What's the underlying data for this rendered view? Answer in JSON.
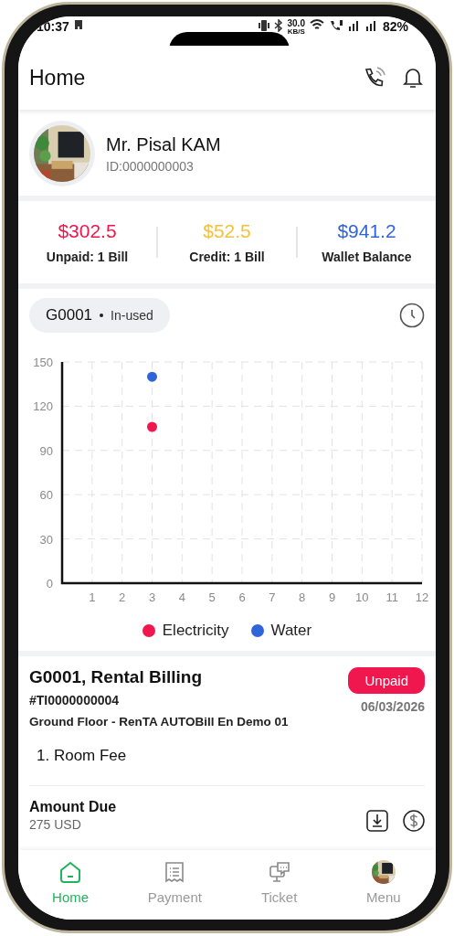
{
  "status_bar": {
    "time": "10:37",
    "speed": "30.0",
    "speed_unit": "KB/S",
    "battery": "82%"
  },
  "header": {
    "title": "Home"
  },
  "profile": {
    "name": "Mr. Pisal KAM",
    "id": "ID:0000000003"
  },
  "balances": [
    {
      "amount": "$302.5",
      "label": "Unpaid: 1 Bill",
      "color": "#f0174f"
    },
    {
      "amount": "$52.5",
      "label": "Credit: 1 Bill",
      "color": "#f5c03c"
    },
    {
      "amount": "$941.2",
      "label": "Wallet Balance",
      "color": "#2f65d8"
    }
  ],
  "usage": {
    "room": "G0001",
    "status": "In-used",
    "chart_data": {
      "type": "scatter",
      "grid": true,
      "x": [
        3
      ],
      "xlim": [
        0,
        12
      ],
      "ylim": [
        0,
        150
      ],
      "xticks": [
        1,
        2,
        3,
        4,
        5,
        6,
        7,
        8,
        9,
        10,
        11,
        12
      ],
      "yticks": [
        0,
        30,
        60,
        90,
        120,
        150
      ],
      "series": [
        {
          "name": "Electricity",
          "color": "#f0174f",
          "values": [
            106
          ]
        },
        {
          "name": "Water",
          "color": "#2f65d8",
          "values": [
            140
          ]
        }
      ]
    }
  },
  "bill": {
    "title": "G0001, Rental Billing",
    "number": "#TI0000000004",
    "location": "Ground Floor - RenTA AUTOBill En Demo 01",
    "status": "Unpaid",
    "date": "06/03/2026",
    "items": [
      "1. Room Fee"
    ],
    "amount_label": "Amount Due",
    "amount": "275 USD"
  },
  "nav": [
    {
      "label": "Home",
      "kind": "home",
      "selected": true
    },
    {
      "label": "Payment",
      "kind": "payment",
      "selected": false
    },
    {
      "label": "Ticket",
      "kind": "ticket",
      "selected": false
    },
    {
      "label": "Menu",
      "kind": "menu",
      "selected": false
    }
  ]
}
